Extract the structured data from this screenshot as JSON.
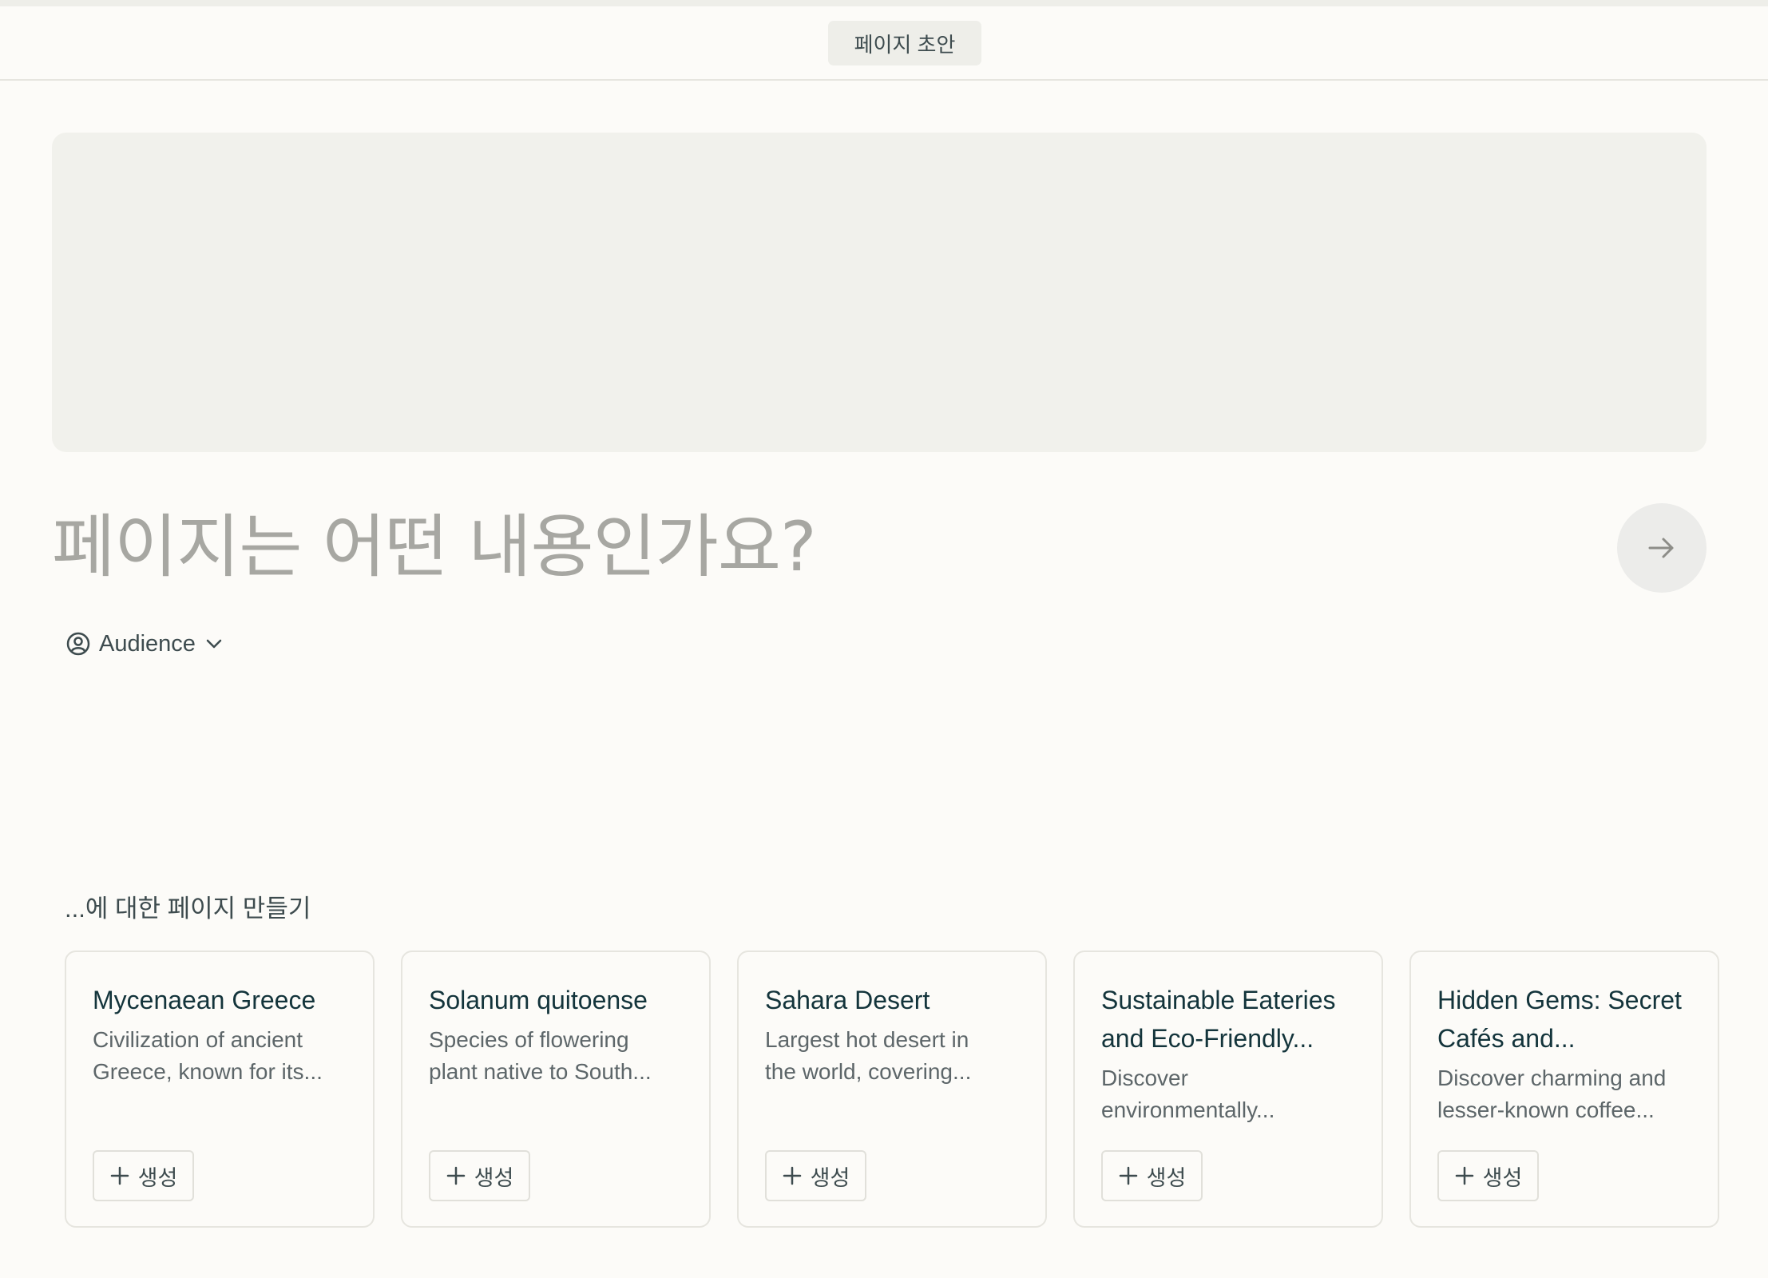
{
  "header": {
    "draft_label": "페이지 초안"
  },
  "prompt": {
    "placeholder": "페이지는 어떤 내용인가요?"
  },
  "audience": {
    "label": "Audience"
  },
  "suggestions": {
    "title": "...에 대한 페이지 만들기",
    "generate_label": "생성",
    "cards": [
      {
        "title": "Mycenaean Greece",
        "desc1": "Civilization of ancient",
        "desc2": "Greece, known for its..."
      },
      {
        "title": "Solanum quitoense",
        "desc1": "Species of flowering",
        "desc2": "plant native to South..."
      },
      {
        "title": "Sahara Desert",
        "desc1": "Largest hot desert in",
        "desc2": "the world, covering..."
      },
      {
        "title": "Sustainable Eateries and Eco-Friendly...",
        "desc1": "Discover",
        "desc2": "environmentally..."
      },
      {
        "title": "Hidden Gems: Secret Cafés and...",
        "desc1": "Discover charming and",
        "desc2": "lesser-known coffee..."
      }
    ]
  },
  "colors": {
    "background": "#fcfbf8",
    "placeholder_block": "#f1f1ec",
    "text_dark": "#13343b"
  }
}
